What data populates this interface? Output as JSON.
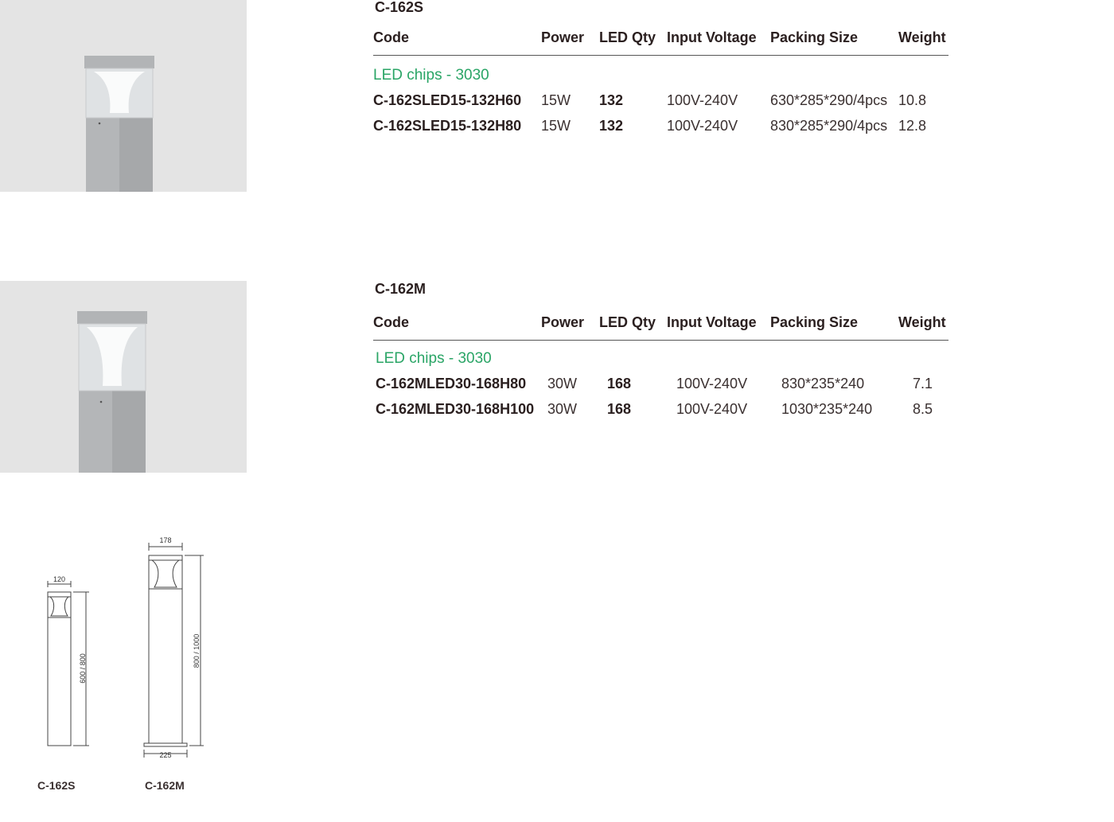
{
  "products": [
    {
      "title": "C-162S",
      "headers": [
        "Code",
        "Power",
        "LED Qty",
        "Input Voltage",
        "Packing Size",
        "Weight"
      ],
      "chips": "LED chips - 3030",
      "rows": [
        [
          "C-162SLED15-132H60",
          "15W",
          "132",
          "100V-240V",
          "630*285*290/4pcs",
          "10.8"
        ],
        [
          "C-162SLED15-132H80",
          "15W",
          "132",
          "100V-240V",
          "830*285*290/4pcs",
          "12.8"
        ]
      ]
    },
    {
      "title": "C-162M",
      "headers": [
        "Code",
        "Power",
        "LED Qty",
        "Input Voltage",
        "Packing Size",
        "Weight"
      ],
      "chips": "LED chips - 3030",
      "rows": [
        [
          "C-162MLED30-168H80",
          "30W",
          "168",
          "100V-240V",
          "830*235*240",
          "7.1"
        ],
        [
          "C-162MLED30-168H100",
          "30W",
          "168",
          "100V-240V",
          "1030*235*240",
          "8.5"
        ]
      ]
    }
  ],
  "drawings": {
    "small": {
      "width": "120",
      "height": "600 / 800",
      "caption": "C-162S"
    },
    "medium": {
      "width": "178",
      "height": "800 / 1000",
      "base": "225",
      "caption": "C-162M"
    }
  },
  "colors": {
    "accent": "#2aa566",
    "photo_bg": "#e4e4e4",
    "body_metal": "#a6a8aa"
  }
}
